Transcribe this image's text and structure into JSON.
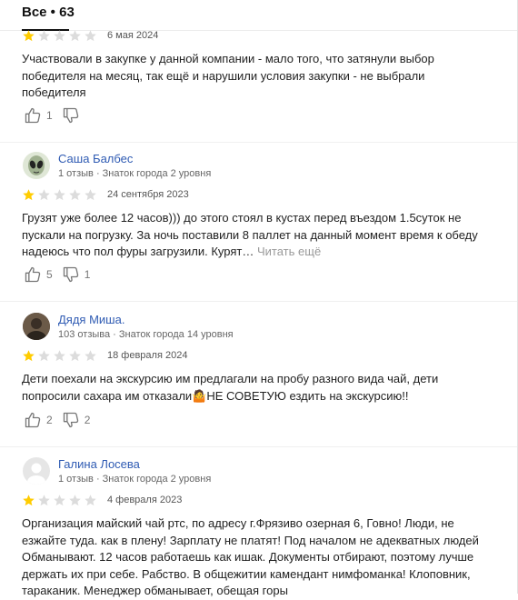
{
  "header": {
    "title": "Все • 63"
  },
  "colors": {
    "star_filled": "#fc0",
    "star_empty": "#dcdcdc",
    "link": "#2f5bb3"
  },
  "reviews": [
    {
      "author": "",
      "meta": "",
      "rating": 1,
      "date": "6 мая 2024",
      "text": "Участвовали в закупке у данной компании - мало того, что затянули выбор победителя на месяц, так ещё и нарушили условия закупки - не выбрали победителя",
      "read_more": "",
      "likes": "1",
      "dislikes": ""
    },
    {
      "author": "Саша Балбес",
      "meta": "1 отзыв · Знаток города 2 уровня",
      "avatar_icon": "alien-face-icon",
      "rating": 1,
      "date": "24 сентября 2023",
      "text": "Грузят уже более 12 часов))) до этого стоял в кустах перед въездом 1.5суток не пускали на погрузку. За ночь поставили 8 паллет на данный момент время к обеду надеюсь что пол фуры загрузили. Курят…",
      "read_more": "Читать ещё",
      "likes": "5",
      "dislikes": "1"
    },
    {
      "author": "Дядя Миша.",
      "meta": "103 отзыва · Знаток города 14 уровня",
      "avatar_icon": "photo-avatar",
      "rating": 1,
      "date": "18 февраля 2024",
      "text": "Дети поехали на экскурсию им предлагали на пробу разного вида чай, дети попросили сахара им отказали🤷НЕ СОВЕТУЮ ездить на экскурсию!!",
      "read_more": "",
      "likes": "2",
      "dislikes": "2"
    },
    {
      "author": "Галина Лосева",
      "meta": "1 отзыв · Знаток города 2 уровня",
      "avatar_icon": "default-user-icon",
      "rating": 1,
      "date": "4 февраля 2023",
      "text": "Организация майский чай ртс, по адресу г.Фрязиво озерная 6, Говно! Люди, не езжайте туда. как в плену! Зарплату не платят! Под началом не адекватных людей Обманывают. 12 часов работаешь как ишак. Документы отбирают, поэтому лучше держать их при себе. Рабство. В общежитии камендант нимфоманка! Клоповник, тараканик. Менеджер обманывает, обещая горы",
      "read_more": "",
      "likes": "",
      "dislikes": ""
    }
  ]
}
